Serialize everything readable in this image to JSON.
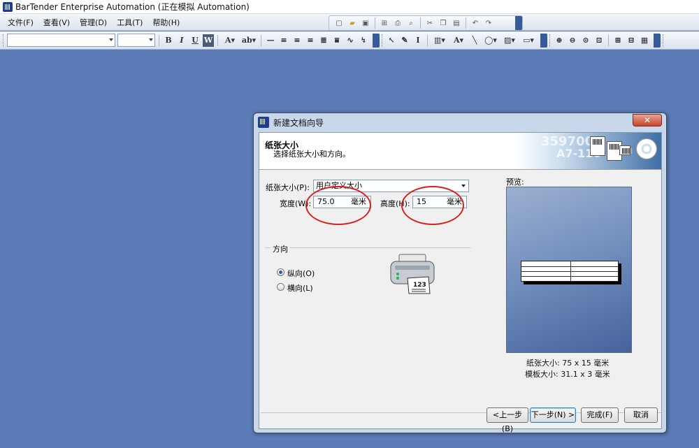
{
  "window": {
    "title": "BarTender Enterprise Automation (正在模拟 Automation)"
  },
  "menu": {
    "items": [
      "文件(F)",
      "查看(V)",
      "管理(D)",
      "工具(T)",
      "帮助(H)"
    ]
  },
  "dialog": {
    "title": "新建文档向导",
    "close_label": "✕",
    "header_title": "纸张大小",
    "header_subtitle": "选择纸张大小和方向。",
    "banner_number": "3597001",
    "banner_code": "A7-116",
    "paper_size_label": "纸张大小(P):",
    "paper_size_value": "用户定义大小",
    "width_label": "宽度(W):",
    "width_value": "75.0",
    "width_unit": "毫米",
    "height_label": "高度(H):",
    "height_value": "15",
    "height_unit": "毫米",
    "orientation_group": "方向",
    "portrait_label": "纵向(O)",
    "landscape_label": "横向(L)",
    "selected_orientation": "portrait",
    "printer_label_text": "123",
    "preview_label": "预览:",
    "paper_size_caption": "纸张大小: 75 x 15 毫米",
    "template_size_caption": "模板大小: 31.1 x 3 毫米",
    "buttons": {
      "back": "<上一步(B)",
      "next": "下一步(N) >",
      "finish": "完成(F)",
      "cancel": "取消"
    }
  },
  "colors": {
    "desktop": "#5a7bb5",
    "highlight_circle": "#d81e1e"
  }
}
